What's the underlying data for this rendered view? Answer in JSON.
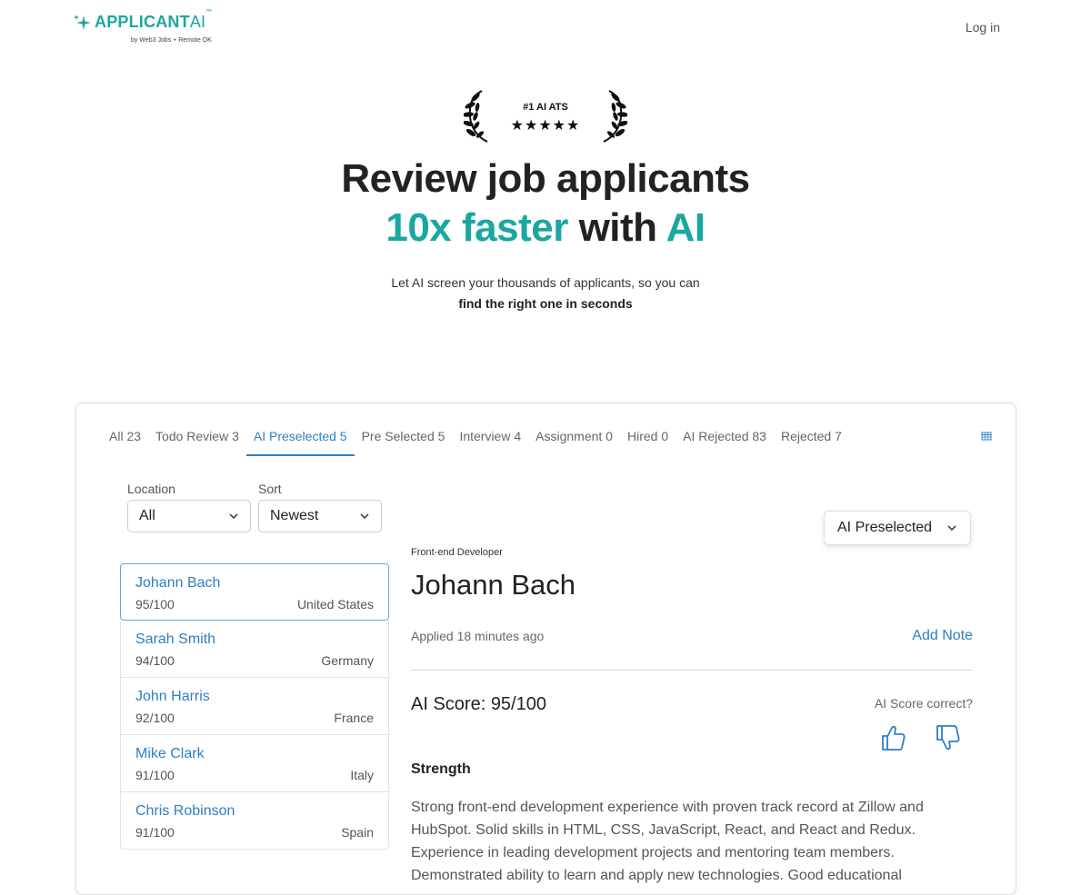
{
  "header": {
    "brand_main": "APPLICANT",
    "brand_ai": "AI",
    "brand_tm": "™",
    "brand_sub": "by Web3 Jobs + Remote OK",
    "login_label": "Log in"
  },
  "hero": {
    "award_title": "#1 AI ATS",
    "award_stars": "★★★★★",
    "headline_line1": "Review job applicants",
    "headline_accent1": "10x faster",
    "headline_middle": " with ",
    "headline_accent2": "AI",
    "subtitle_line1": "Let AI screen your thousands of applicants, so you can",
    "subtitle_line2": "find the right one in seconds"
  },
  "tabs": [
    {
      "label": "All 23",
      "active": false
    },
    {
      "label": "Todo Review 3",
      "active": false
    },
    {
      "label": "AI Preselected 5",
      "active": true
    },
    {
      "label": "Pre Selected 5",
      "active": false
    },
    {
      "label": "Interview 4",
      "active": false
    },
    {
      "label": "Assignment 0",
      "active": false
    },
    {
      "label": "Hired 0",
      "active": false
    },
    {
      "label": "AI Rejected 83",
      "active": false
    },
    {
      "label": "Rejected 7",
      "active": false
    }
  ],
  "filters": {
    "location_label": "Location",
    "location_value": "All",
    "sort_label": "Sort",
    "sort_value": "Newest"
  },
  "candidates": [
    {
      "name": "Johann Bach",
      "score": "95/100",
      "location": "United States",
      "selected": true
    },
    {
      "name": "Sarah Smith",
      "score": "94/100",
      "location": "Germany",
      "selected": false
    },
    {
      "name": "John Harris",
      "score": "92/100",
      "location": "France",
      "selected": false
    },
    {
      "name": "Mike Clark",
      "score": "91/100",
      "location": "Italy",
      "selected": false
    },
    {
      "name": "Chris Robinson",
      "score": "91/100",
      "location": "Spain",
      "selected": false
    }
  ],
  "detail": {
    "status_value": "AI Preselected",
    "role": "Front-end Developer",
    "name": "Johann Bach",
    "applied": "Applied 18 minutes ago",
    "add_note": "Add Note",
    "score": "AI Score: 95/100",
    "score_question": "AI Score correct?",
    "strength_heading": "Strength",
    "strength_text": "Strong front-end development experience with proven track record at Zillow and HubSpot. Solid skills in HTML, CSS, JavaScript, React, and React and Redux. Experience in leading development projects and mentoring team members. Demonstrated ability to learn and apply new technologies. Good educational"
  },
  "colors": {
    "brand_teal": "#1aa7a0",
    "link_blue": "#2e7fc4"
  },
  "icons": [
    "sparkle-icon",
    "laurel-left-icon",
    "laurel-right-icon",
    "table-icon",
    "chevron-down-icon",
    "thumbs-up-icon",
    "thumbs-down-icon"
  ]
}
